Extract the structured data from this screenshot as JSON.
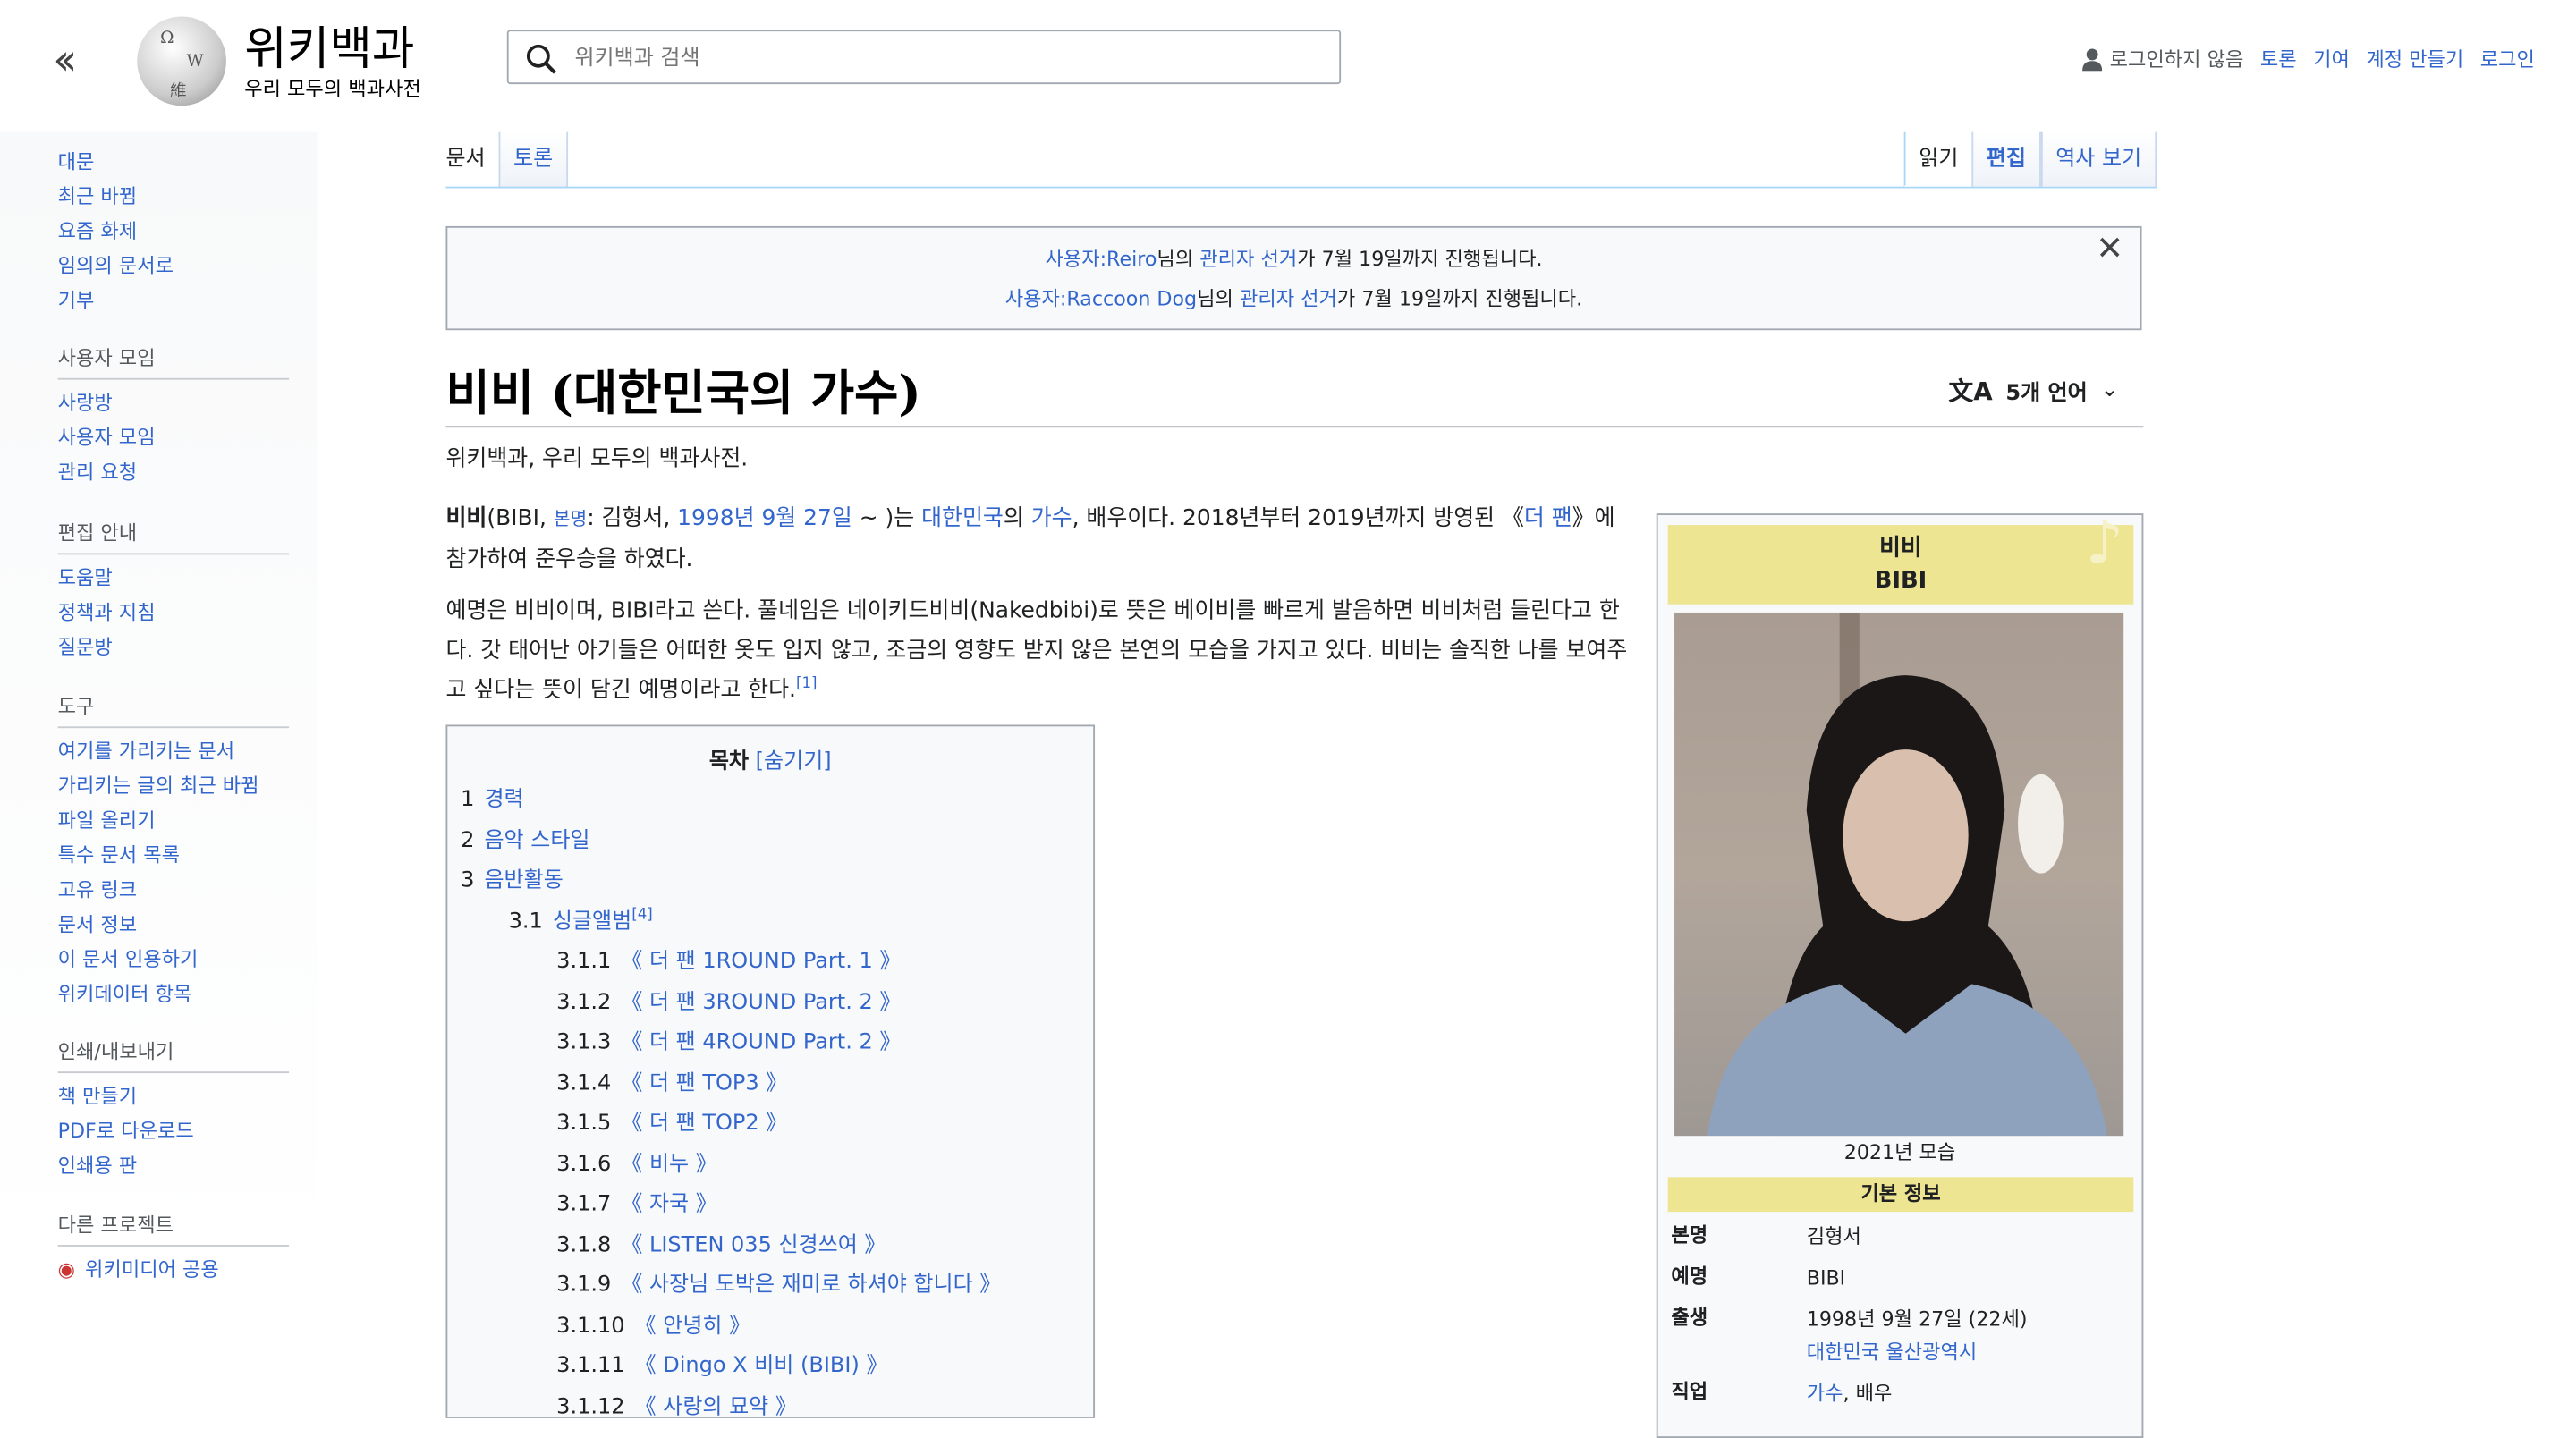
{
  "header": {
    "collapse_icon": "double-chevron-left-icon",
    "title": "위키백과",
    "subtitle": "우리 모두의 백과사전",
    "search_placeholder": "위키백과 검색",
    "user": {
      "status": "로그인하지 않음",
      "links": [
        "토론",
        "기여",
        "계정 만들기",
        "로그인"
      ]
    }
  },
  "sidebar": {
    "main": [
      "대문",
      "최근 바뀜",
      "요즘 화제",
      "임의의 문서로",
      "기부"
    ],
    "sections": [
      {
        "heading": "사용자 모임",
        "items": [
          "사랑방",
          "사용자 모임",
          "관리 요청"
        ]
      },
      {
        "heading": "편집 안내",
        "items": [
          "도움말",
          "정책과 지침",
          "질문방"
        ]
      },
      {
        "heading": "도구",
        "items": [
          "여기를 가리키는 문서",
          "가리키는 글의 최근 바뀜",
          "파일 올리기",
          "특수 문서 목록",
          "고유 링크",
          "문서 정보",
          "이 문서 인용하기",
          "위키데이터 항목"
        ]
      },
      {
        "heading": "인쇄/내보내기",
        "items": [
          "책 만들기",
          "PDF로 다운로드",
          "인쇄용 판"
        ]
      },
      {
        "heading": "다른 프로젝트",
        "items": [
          "위키미디어 공용"
        ]
      }
    ]
  },
  "tabs": {
    "left": [
      "문서",
      "토론"
    ],
    "right": [
      "읽기",
      "편집",
      "역사 보기"
    ]
  },
  "notice": {
    "line1": {
      "user": "사용자:Reiro",
      "mid": "님의 ",
      "link": "관리자 선거",
      "end": "가 7월 19일까지 진행됩니다."
    },
    "line2": {
      "user": "사용자:Raccoon Dog",
      "mid": "님의 ",
      "link": "관리자 선거",
      "end": "가 7월 19일까지 진행됩니다."
    }
  },
  "article": {
    "title": "비비 (대한민국의 가수)",
    "languages": "5개 언어",
    "tagline": "위키백과, 우리 모두의 백과사전.",
    "p1": {
      "bold": "비비",
      "a": "(BIBI, ",
      "realname_label": "본명",
      "b": ": 김형서, ",
      "date": "1998년 9월 27일",
      "c": " ~ )는 ",
      "country": "대한민국",
      "d": "의 ",
      "job": "가수",
      "e": ", 배우이다. 2018년부터 2019년까지 방영된 《",
      "show": "더 팬",
      "f": "》에 참가하여 준우승을 하였다."
    },
    "p2": "예명은 비비이며, BIBI라고 쓴다. 풀네임은 네이키드비비(Nakedbibi)로 뜻은 베이비를 빠르게 발음하면 비비처럼 들린다고 한다. 갓 태어난 아기들은 어떠한 옷도 입지 않고, 조금의 영향도 받지 않은 본연의 모습을 가지고 있다. 비비는 솔직한 나를 보여주고 싶다는 뜻이 담긴 예명이라고 한다.",
    "p2_ref": "[1]"
  },
  "toc": {
    "title": "목차",
    "toggle": "[숨기기]",
    "items": [
      {
        "num": "1",
        "label": "경력",
        "level": 1
      },
      {
        "num": "2",
        "label": "음악 스타일",
        "level": 1
      },
      {
        "num": "3",
        "label": "음반활동",
        "level": 1
      },
      {
        "num": "3.1",
        "label": "싱글앨범",
        "ref": "[4]",
        "level": 2
      },
      {
        "num": "3.1.1",
        "label": "《 더 팬 1ROUND Part. 1 》",
        "level": 3
      },
      {
        "num": "3.1.2",
        "label": "《 더 팬 3ROUND Part. 2 》",
        "level": 3
      },
      {
        "num": "3.1.3",
        "label": "《 더 팬 4ROUND Part. 2 》",
        "level": 3
      },
      {
        "num": "3.1.4",
        "label": "《 더 팬 TOP3 》",
        "level": 3
      },
      {
        "num": "3.1.5",
        "label": "《 더 팬 TOP2 》",
        "level": 3
      },
      {
        "num": "3.1.6",
        "label": "《 비누 》",
        "level": 3
      },
      {
        "num": "3.1.7",
        "label": "《 자국 》",
        "level": 3
      },
      {
        "num": "3.1.8",
        "label": "《 LISTEN 035 신경쓰여 》",
        "level": 3
      },
      {
        "num": "3.1.9",
        "label": "《 사장님 도박은 재미로 하셔야 합니다 》",
        "level": 3
      },
      {
        "num": "3.1.10",
        "label": "《 안녕히 》",
        "level": 3
      },
      {
        "num": "3.1.11",
        "label": "《 Dingo X 비비 (BIBI) 》",
        "level": 3
      },
      {
        "num": "3.1.12",
        "label": "《 사랑의 묘약 》",
        "level": 3
      }
    ]
  },
  "infobox": {
    "name_ko": "비비",
    "name_en": "BIBI",
    "caption": "2021년 모습",
    "section": "기본 정보",
    "rows": {
      "realname": {
        "k": "본명",
        "v": "김형서"
      },
      "stage": {
        "k": "예명",
        "v": "BIBI"
      },
      "birth": {
        "k": "출생",
        "v": "1998년 9월 27일 (22세)",
        "place": "대한민국 울산광역시"
      },
      "job": {
        "k": "직업",
        "v1": "가수",
        "v2": ", 배우"
      }
    }
  },
  "colors": {
    "link": "#3366cc",
    "infobox_header": "#ede592"
  }
}
